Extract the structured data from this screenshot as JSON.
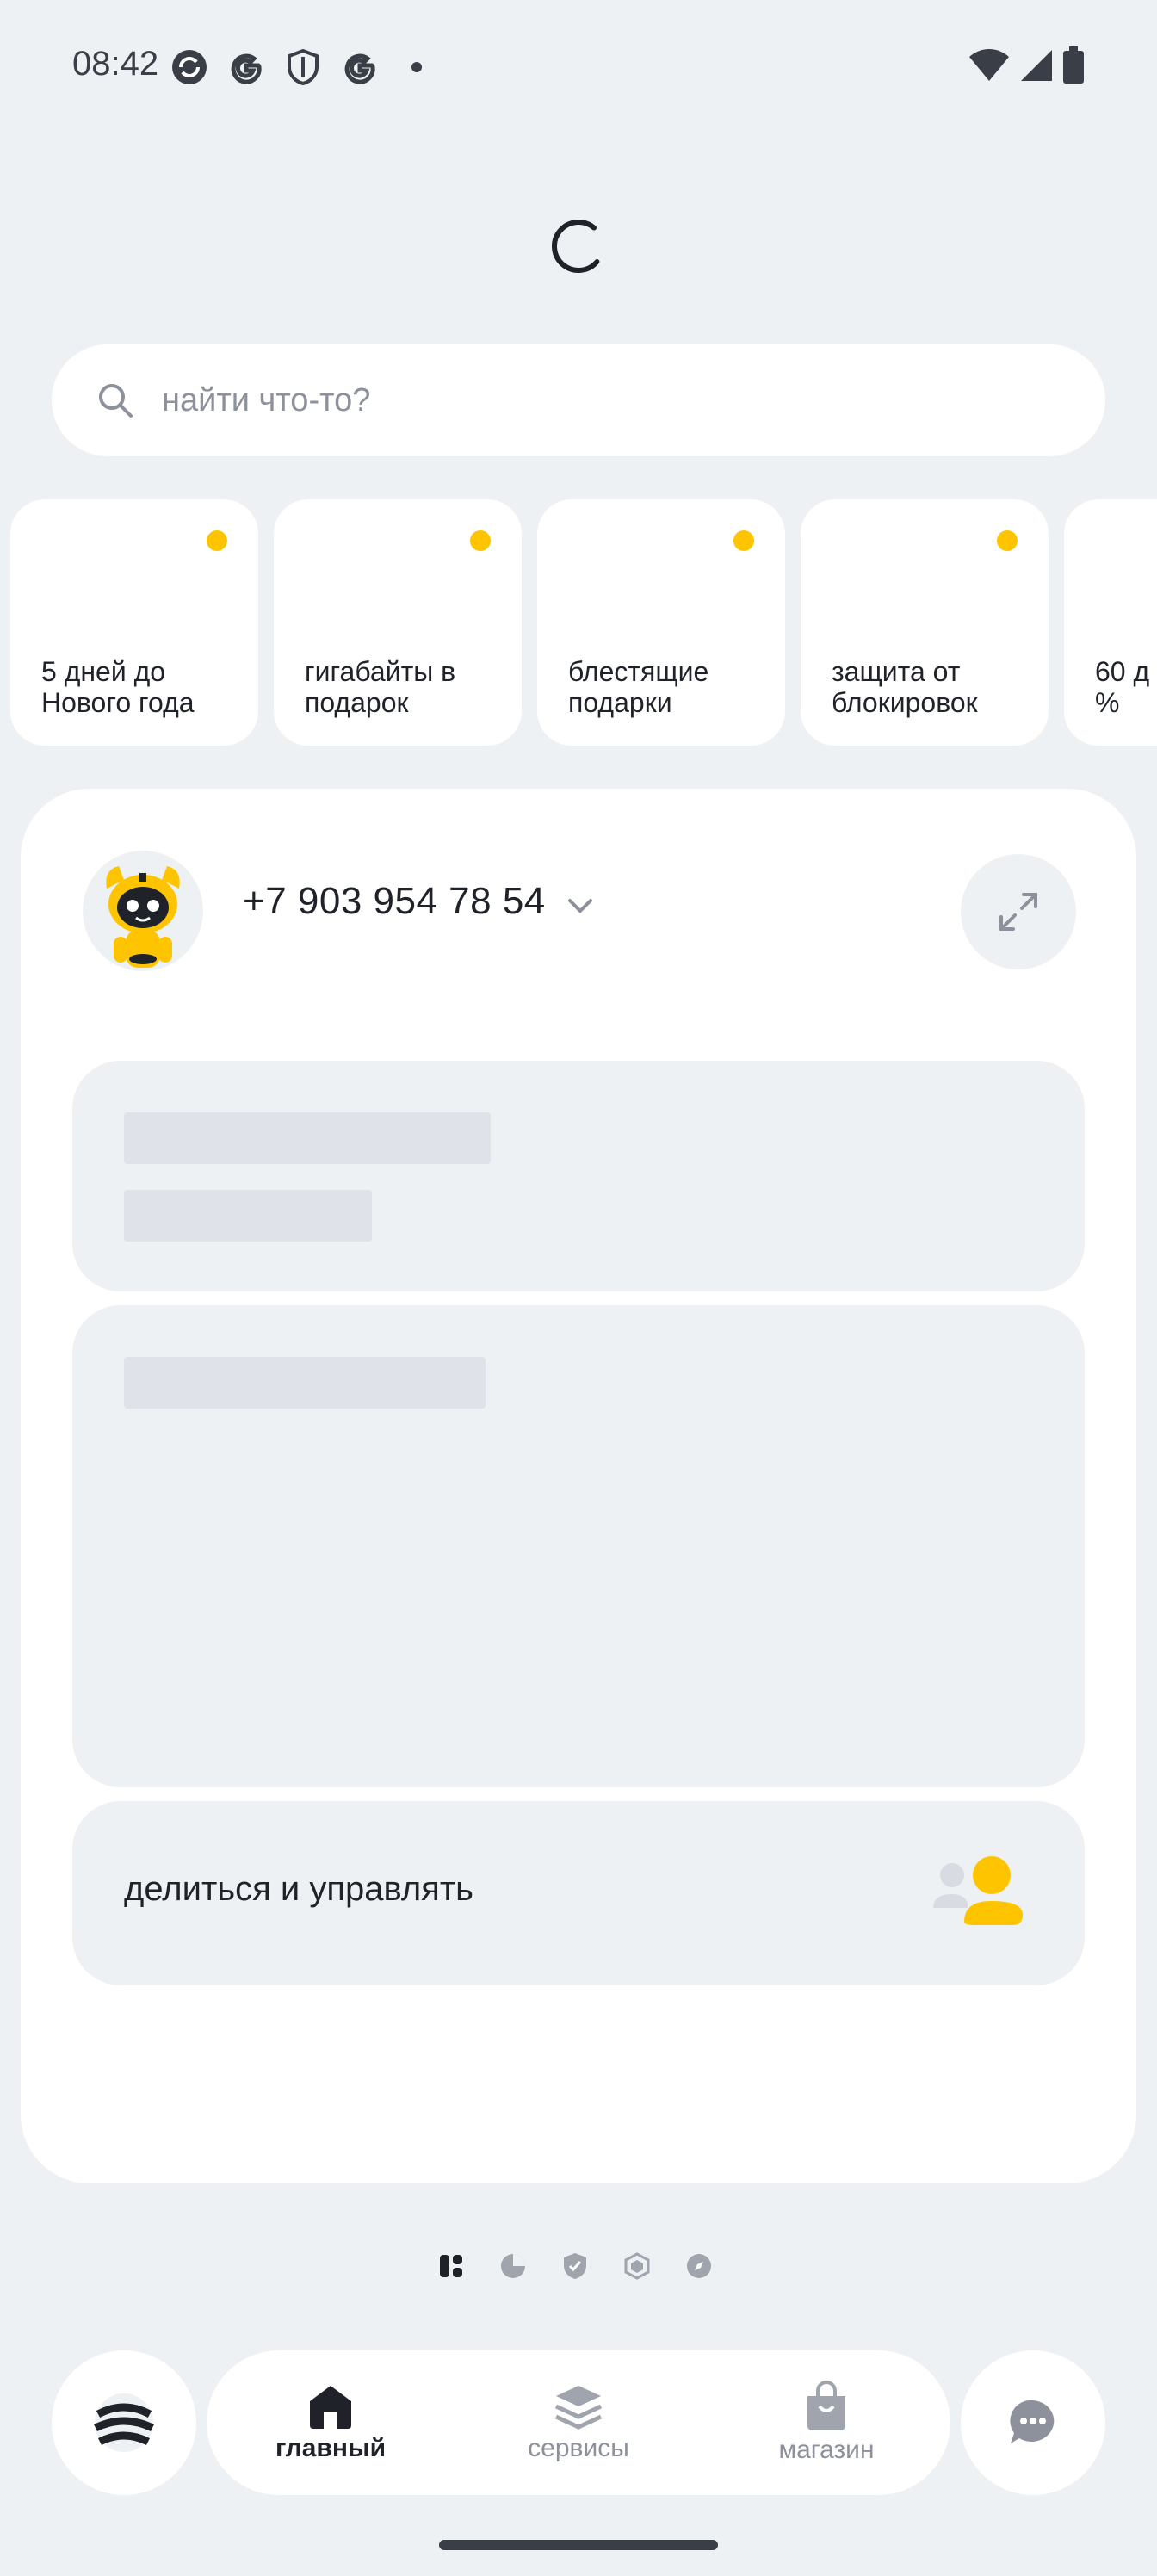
{
  "status_bar": {
    "time": "08:42",
    "left_icons": [
      "sync-icon",
      "google-icon",
      "shield-icon",
      "google-icon",
      "dot-icon"
    ],
    "right_icons": [
      "wifi-icon",
      "signal-icon",
      "battery-icon"
    ]
  },
  "search": {
    "placeholder": "найти что-то?",
    "value": ""
  },
  "stories": [
    {
      "label": "5 дней до\nНового года",
      "unread": true
    },
    {
      "label": "гигабайты в\nподарок",
      "unread": true
    },
    {
      "label": "блестящие\nподарки",
      "unread": true
    },
    {
      "label": "защита от\nблокировок",
      "unread": true
    },
    {
      "label": "60 д\n%",
      "unread": false
    }
  ],
  "account": {
    "phone": "+7 903 954 78 54",
    "avatar_icon": "robot-avatar-icon",
    "expand_icon": "expand-icon"
  },
  "share": {
    "label": "делиться и управлять",
    "icon": "users-icon"
  },
  "pager": {
    "pages": [
      "widgets-icon",
      "pie-chart-icon",
      "shield-check-icon",
      "hexagon-icon",
      "compass-icon"
    ],
    "active_index": 0
  },
  "nav": {
    "items": [
      {
        "label": "главный",
        "icon": "home-icon",
        "active": true
      },
      {
        "label": "сервисы",
        "icon": "layers-icon",
        "active": false
      },
      {
        "label": "магазин",
        "icon": "shopping-bag-icon",
        "active": false
      }
    ],
    "left_icon": "beeline-logo-icon",
    "right_icon": "chat-icon"
  },
  "colors": {
    "accent": "#FFC400",
    "background": "#EEF1F4",
    "card": "#FFFFFF",
    "text": "#1F2329",
    "muted": "#8C919B"
  }
}
